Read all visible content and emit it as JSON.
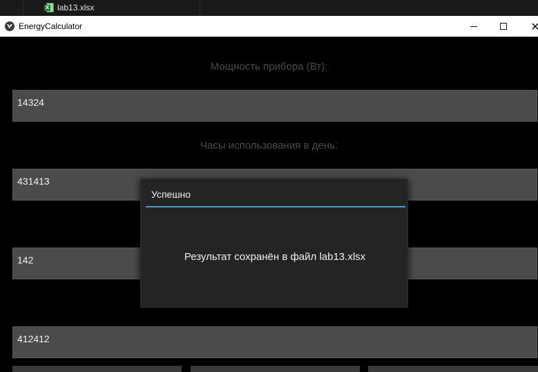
{
  "explorer": {
    "file_name": "lab13.xlsx",
    "file_icon": "excel-file-icon"
  },
  "window": {
    "title": "EnergyCalculator",
    "app_icon": "kivy-logo-icon",
    "controls": {
      "minimize": "minimize-icon",
      "maximize": "maximize-icon",
      "close": "✕"
    }
  },
  "form": {
    "power_label": "Мощность прибора (Вт):",
    "power_value": "14324",
    "hours_label": "Часы использования в день:",
    "hours_value": "431413",
    "third_value": "142",
    "fourth_value": "412412"
  },
  "popup": {
    "title": "Успешно",
    "message": "Результат сохранён в файл lab13.xlsx",
    "accent_color": "#3aa3d8"
  }
}
